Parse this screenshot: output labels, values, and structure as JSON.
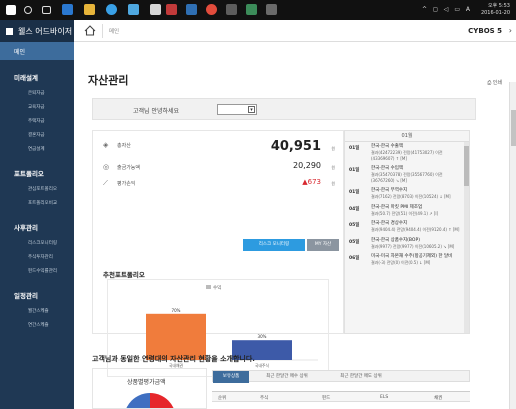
{
  "window": {
    "clock": "오후 5:53",
    "date": "2016-01-20",
    "tray_text": "A",
    "title": "웰스 어드바이저",
    "brand": "CYBOS 5"
  },
  "sidebar": {
    "home_label": "메인",
    "sections": [
      {
        "title": "미래설계",
        "items": [
          "은퇴자금",
          "교육자금",
          "주택자금",
          "결혼자금",
          "연금설계"
        ]
      },
      {
        "title": "포트폴리오",
        "items": [
          "관심포트폴리오",
          "포트폴리오비교"
        ]
      },
      {
        "title": "사후관리",
        "items": [
          "리스크모니터링",
          "주식투자관리",
          "펀드수익률관리"
        ]
      },
      {
        "title": "일정관리",
        "items": [
          "월간스케쥴",
          "연간스케쥴"
        ]
      }
    ]
  },
  "topbar": {
    "breadcrumb": "메인"
  },
  "page": {
    "title": "자산관리",
    "print_label": "인쇄",
    "greeting": "고객님 안녕하세요",
    "greeting_select_value": ""
  },
  "assets": {
    "total_label": "총자산",
    "total_value": "40,951",
    "cash_label": "출금가능액",
    "cash_value": "20,290",
    "pnl_label": "평가손익",
    "pnl_value": "▲673",
    "unit": "원",
    "risk_button": "리스크 모니터링",
    "my_asset_button": "MY 자산"
  },
  "portfolio": {
    "title": "추천포트폴리오",
    "legend": "수익",
    "colors": {
      "orange": "#f07c3c",
      "blue": "#3d5aa8"
    },
    "chart_data": {
      "type": "bar",
      "categories": [
        "국내채권",
        "국내주식"
      ],
      "values": [
        70,
        30
      ],
      "ylim": [
        0,
        100
      ]
    },
    "value_labels": [
      "70%",
      "30%"
    ]
  },
  "news": {
    "header": "01월",
    "items": [
      {
        "date": "01일",
        "title": "한국-한국 수출액",
        "detail": "결과(42472239) 전망(41753027) 이전(43369607) ↑ [M]"
      },
      {
        "date": "01일",
        "title": "한국-한국 수입액",
        "detail": "결과(35470378) 전망(35567760) 이전(36767260) ↘ [M]"
      },
      {
        "date": "01일",
        "title": "한국-한국 무역수지",
        "detail": "결과(7162) 전망(8703) 이전(10524) ↓ [M]"
      },
      {
        "date": "04일",
        "title": "한국-한국 마킷 PMI 제조업",
        "detail": "결과(50.7) 전망(51) 이전(49.1) ↗ [I]"
      },
      {
        "date": "05일",
        "title": "한국-한국 경상수지",
        "detail": "결과(9404.4) 전망(9404.4) 이전(9120.4) ↑ [M]"
      },
      {
        "date": "05일",
        "title": "한국-한국 상품수지(BOP)",
        "detail": "결과(9977) 전망(9977) 이전(10605.2) ↘ [M]"
      },
      {
        "date": "06일",
        "title": "미국-미국 자본재 수주(항공기제외) 한 달비",
        "detail": "결과(-3) 전망(0) 이전(0.5) ↓ [M]"
      }
    ]
  },
  "bottom": {
    "title": "고객님과 동일한 연령대의 자산관리 현황을 소개합니다.",
    "donut_title": "상품별평가금액",
    "tabs": [
      "보유상품",
      "최근 한달간 매수 상위",
      "최근 한달간 매도 상위"
    ],
    "table_headers": [
      "순위",
      "주식",
      "펀드",
      "ELS",
      "채권"
    ]
  }
}
